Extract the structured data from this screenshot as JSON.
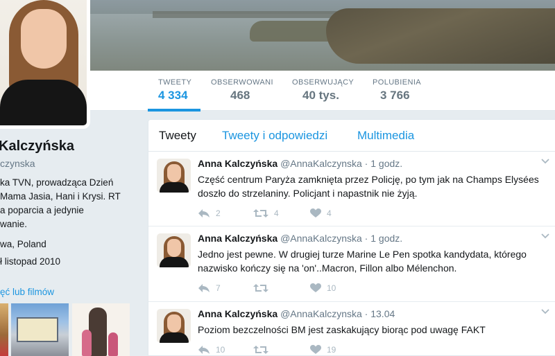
{
  "profile": {
    "name": "Kalczyńska",
    "handle": "czynska",
    "bio_lines": [
      "ka TVN, prowadząca Dzień",
      "Mama Jasia, Hani i Krysi. RT",
      "a poparcia a jedynie",
      "wanie."
    ],
    "location": "wa, Poland",
    "joined": "ł listopad 2010",
    "media_link": "ęć lub filmów"
  },
  "stats": [
    {
      "label": "TWEETY",
      "value": "4 334",
      "active": true
    },
    {
      "label": "OBSERWOWANI",
      "value": "468",
      "active": false
    },
    {
      "label": "OBSERWUJĄCY",
      "value": "40 tys.",
      "active": false
    },
    {
      "label": "POLUBIENIA",
      "value": "3 766",
      "active": false
    }
  ],
  "tabs": [
    {
      "label": "Tweety",
      "active": true
    },
    {
      "label": "Tweety i odpowiedzi",
      "active": false
    },
    {
      "label": "Multimedia",
      "active": false
    }
  ],
  "tweets": [
    {
      "name": "Anna Kalczyńska",
      "handle": "@AnnaKalczynska",
      "dot": "·",
      "time": "1 godz.",
      "text": "Część centrum Paryża zamknięta przez Policję, po tym jak na Champs Elysées doszło do strzelaniny. Policjant i napastnik nie żyją.",
      "replies": "2",
      "retweets": "4",
      "likes": "4"
    },
    {
      "name": "Anna Kalczyńska",
      "handle": "@AnnaKalczynska",
      "dot": "·",
      "time": "1 godz.",
      "text": "Jedno jest pewne. W drugiej turze Marine Le Pen spotka kandydata, którego nazwisko kończy się na 'on'..Macron, Fillon albo Mélenchon.",
      "replies": "7",
      "retweets": "",
      "likes": "10"
    },
    {
      "name": "Anna Kalczyńska",
      "handle": "@AnnaKalczynska",
      "dot": "·",
      "time": "13.04",
      "text": "Poziom bezczelności BM jest zaskakujący biorąc pod uwagę FAKT",
      "replies": "10",
      "retweets": "",
      "likes": "19"
    }
  ],
  "colors": {
    "accent": "#1b95e0",
    "muted": "#657786",
    "icon": "#aab8c2",
    "background": "#e6ecf0"
  },
  "icons": {
    "reply": "reply-icon",
    "retweet": "retweet-icon",
    "like": "heart-icon",
    "caret": "chevron-down-icon"
  }
}
